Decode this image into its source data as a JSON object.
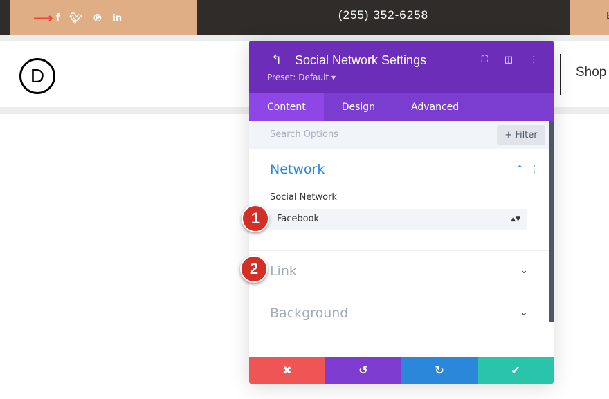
{
  "topbar": {
    "phone": "(255) 352-6258",
    "social_icons": [
      "facebook-icon",
      "twitter-icon",
      "pinterest-icon",
      "linkedin-icon"
    ],
    "right_partial": "E",
    "arrow_color": "#e8453c"
  },
  "header": {
    "logo": "D",
    "nav_item": "Shop"
  },
  "modal": {
    "title": "Social Network Settings",
    "preset": "Preset: Default",
    "tabs": [
      {
        "label": "Content"
      },
      {
        "label": "Design"
      },
      {
        "label": "Advanced"
      }
    ],
    "search_placeholder": "Search Options",
    "filter_label": "Filter",
    "sections": {
      "network": {
        "title": "Network",
        "field_label": "Social Network",
        "value": "Facebook"
      },
      "link": {
        "title": "Link"
      },
      "background": {
        "title": "Background"
      }
    },
    "colors": {
      "header": "#6c2eb9",
      "accent": "#2b87da",
      "cancel": "#ef5555",
      "undo": "#7e3bd0",
      "redo": "#2b87da",
      "save": "#29c4a9"
    }
  },
  "annotations": [
    "1",
    "2"
  ]
}
